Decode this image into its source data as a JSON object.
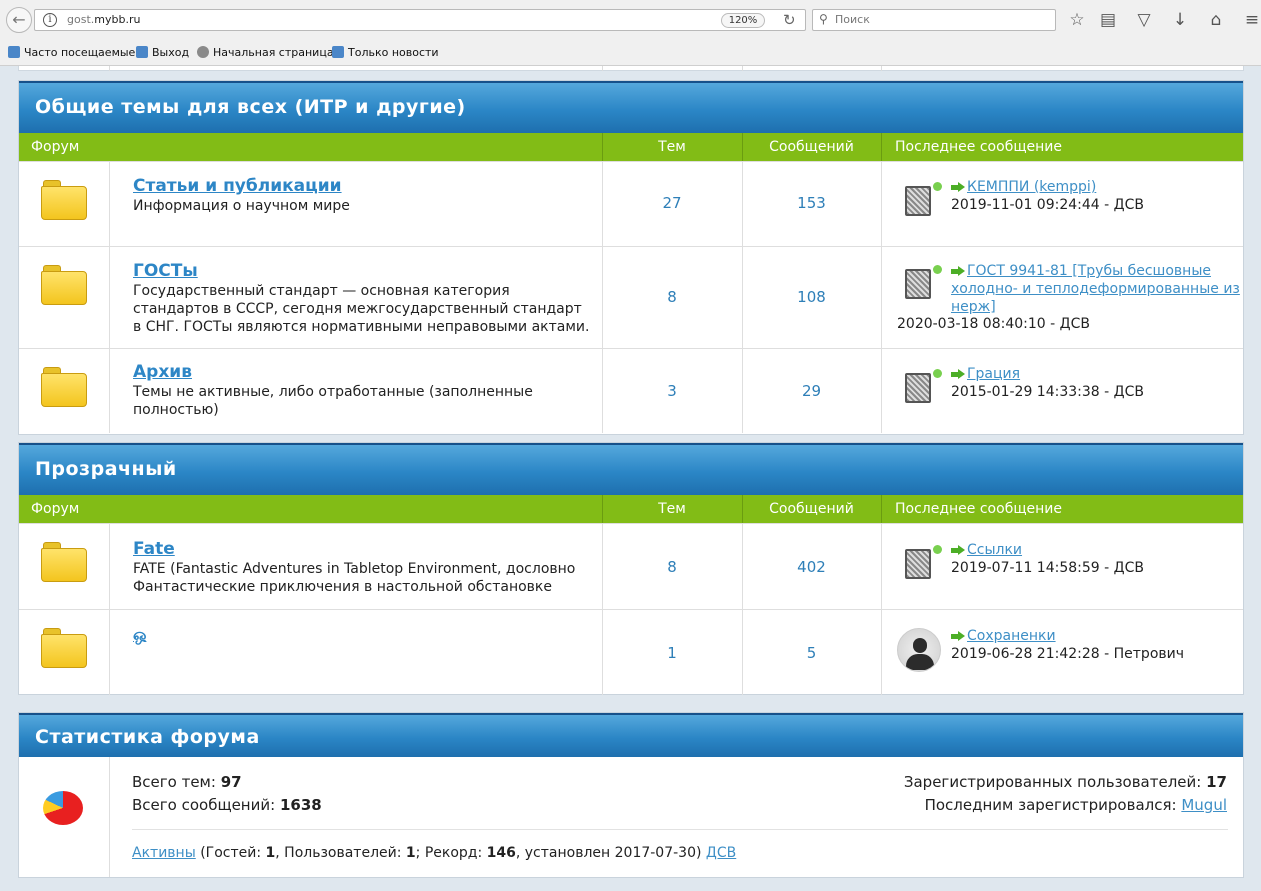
{
  "browser": {
    "url_host_prefix": "gost.",
    "url_host_main": "mybb.ru",
    "zoom": "120%",
    "search_placeholder": "Поиск",
    "bookmarks": [
      "Часто посещаемые",
      "Выход",
      "Начальная страница",
      "Только новости"
    ]
  },
  "columns": {
    "forum": "Форум",
    "topics": "Тем",
    "posts": "Сообщений",
    "last": "Последнее сообщение"
  },
  "categories": [
    {
      "title": "Общие темы для всех (ИТР и другие)",
      "forums": [
        {
          "name": "Статьи и публикации",
          "desc": "Информация о научном мире",
          "topics": "27",
          "posts": "153",
          "last_topic": "КЕМППИ (kemppi)",
          "last_date": "2019-11-01 09:24:44 - ДСВ"
        },
        {
          "name": "ГОСТы",
          "desc": "Государственный стандарт — основная категория стандартов в СССР, сегодня межгосударственный стандарт в СНГ. ГОСТы являются нормативными неправовыми актами.",
          "topics": "8",
          "posts": "108",
          "last_topic": "ГОСТ 9941-81 [Трубы бесшовные холодно- и теплодеформированные из нерж]",
          "last_date": "2020-03-18 08:40:10 - ДСВ"
        },
        {
          "name": "Архив",
          "desc": "Темы не активные, либо отработанные (заполненные полностью)",
          "topics": "3",
          "posts": "29",
          "last_topic": "Грация",
          "last_date": "2015-01-29 14:33:38 - ДСВ"
        }
      ]
    },
    {
      "title": "Прозрачный",
      "forums": [
        {
          "name": "Fate",
          "desc": "FATE (Fantastic Adventures in Tabletop Environment, дословно Фантастические приключения в настольной обстановке",
          "topics": "8",
          "posts": "402",
          "last_topic": "Ссылки",
          "last_date": "2019-07-11 14:58:59 - ДСВ"
        },
        {
          "name": "ஒ",
          "desc": "",
          "topics": "1",
          "posts": "5",
          "last_topic": "Сохраненки",
          "last_date": "2019-06-28 21:42:28 - Петрович"
        }
      ]
    }
  ],
  "stats": {
    "title": "Статистика форума",
    "total_topics_label": "Всего тем:",
    "total_topics": "97",
    "total_posts_label": "Всего сообщений:",
    "total_posts": "1638",
    "registered_label": "Зарегистрированных пользователей:",
    "registered": "17",
    "last_registered_label": "Последним зарегистрировался:",
    "last_registered": "Mugul",
    "active_link": "Активны",
    "guests_label": "(Гостей:",
    "guests": "1",
    "users_label": ", Пользователей:",
    "users": "1",
    "record_label": "; Рекорд:",
    "record": "146",
    "record_date": ", установлен 2017-07-30)",
    "record_user": "ДСВ"
  }
}
